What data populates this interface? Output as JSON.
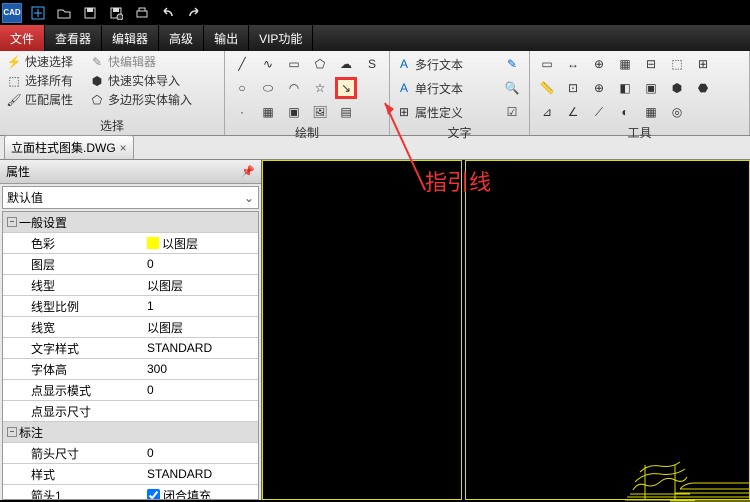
{
  "app": {
    "name": "CAD"
  },
  "menu": {
    "file": "文件",
    "viewer": "查看器",
    "editor": "编辑器",
    "advanced": "高级",
    "output": "输出",
    "vip": "VIP功能"
  },
  "ribbon": {
    "select": {
      "quick": "快速选择",
      "quickedit": "快编辑器",
      "all": "选择所有",
      "solid": "快速实体导入",
      "match": "匹配属性",
      "poly": "多边形实体输入",
      "label": "选择"
    },
    "draw": {
      "label": "绘制"
    },
    "text": {
      "mtext": "多行文本",
      "stext": "单行文本",
      "attdef": "属性定义",
      "label": "文字"
    },
    "tools": {
      "label": "工具"
    }
  },
  "file": {
    "tab": "立面柱式图集.DWG"
  },
  "props": {
    "title": "属性",
    "combo": "默认值",
    "cat1": "一般设置",
    "rows1": [
      {
        "k": "色彩",
        "v": "以图层",
        "swatch": true
      },
      {
        "k": "图层",
        "v": "0"
      },
      {
        "k": "线型",
        "v": "以图层"
      },
      {
        "k": "线型比例",
        "v": "1"
      },
      {
        "k": "线宽",
        "v": "以图层"
      },
      {
        "k": "文字样式",
        "v": "STANDARD"
      },
      {
        "k": "字体高",
        "v": "300"
      },
      {
        "k": "点显示模式",
        "v": "0"
      },
      {
        "k": "点显示尺寸",
        "v": ""
      }
    ],
    "cat2": "标注",
    "rows2": [
      {
        "k": "箭头尺寸",
        "v": "0"
      },
      {
        "k": "样式",
        "v": "STANDARD"
      },
      {
        "k": "箭头1",
        "v": "闭合填充",
        "cb": true
      }
    ]
  },
  "annotation": "指引线"
}
